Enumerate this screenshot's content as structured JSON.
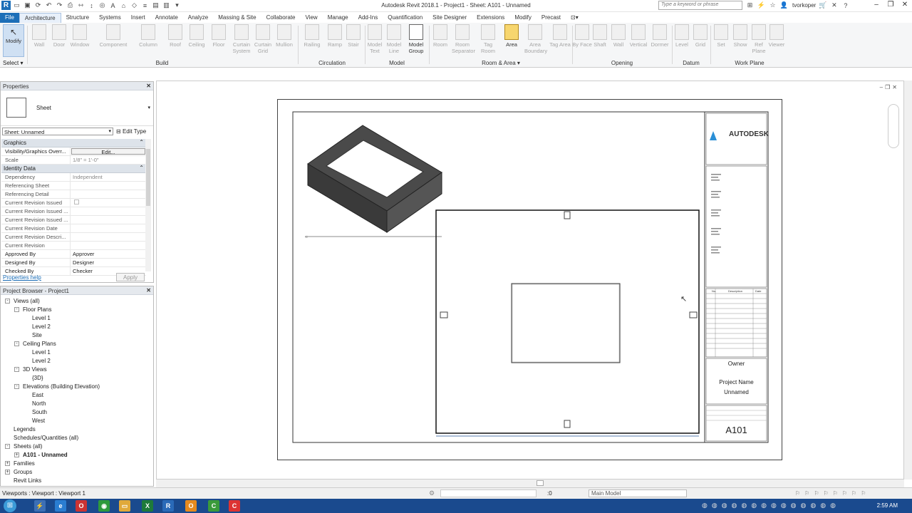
{
  "window": {
    "title": "Autodesk Revit 2018.1 -    Project1 - Sheet: A101 - Unnamed",
    "search_placeholder": "Type a keyword or phrase",
    "user": "tvorkoper"
  },
  "tabs": [
    "Architecture",
    "Structure",
    "Systems",
    "Insert",
    "Annotate",
    "Analyze",
    "Massing & Site",
    "Collaborate",
    "View",
    "Manage",
    "Add-Ins",
    "Quantification",
    "Site Designer",
    "Extensions",
    "Modify",
    "Precast"
  ],
  "file_tab": "File",
  "ribbon": {
    "modify": "Modify",
    "select": "Select",
    "buttons": [
      {
        "label": "Wall"
      },
      {
        "label": "Door"
      },
      {
        "label": "Window"
      },
      {
        "label": "Component"
      },
      {
        "label": "Column"
      },
      {
        "label": "Roof"
      },
      {
        "label": "Ceiling"
      },
      {
        "label": "Floor"
      },
      {
        "label": "Curtain System"
      },
      {
        "label": "Curtain Grid"
      },
      {
        "label": "Mullion"
      },
      {
        "label": "Railing"
      },
      {
        "label": "Ramp"
      },
      {
        "label": "Stair"
      },
      {
        "label": "Model Text"
      },
      {
        "label": "Model Line"
      },
      {
        "label": "Model Group"
      },
      {
        "label": "Room"
      },
      {
        "label": "Room Separator"
      },
      {
        "label": "Tag Room"
      },
      {
        "label": "Area"
      },
      {
        "label": "Area Boundary"
      },
      {
        "label": "Tag Area"
      },
      {
        "label": "By Face"
      },
      {
        "label": "Shaft"
      },
      {
        "label": "Wall"
      },
      {
        "label": "Vertical"
      },
      {
        "label": "Dormer"
      },
      {
        "label": "Level"
      },
      {
        "label": "Grid"
      },
      {
        "label": "Set"
      },
      {
        "label": "Show"
      },
      {
        "label": "Ref Plane"
      },
      {
        "label": "Viewer"
      }
    ],
    "panels": [
      "Build",
      "Circulation",
      "Model",
      "Room & Area",
      "Opening",
      "Datum",
      "Work Plane"
    ]
  },
  "properties": {
    "title": "Properties",
    "type": "Sheet",
    "instance": "Sheet: Unnamed",
    "edit_type": "Edit Type",
    "groups": [
      "Graphics",
      "Identity Data"
    ],
    "rows": [
      {
        "k": "Visibility/Graphics Overr...",
        "v": "Edit..."
      },
      {
        "k": "Scale",
        "v": "1/8\" = 1'-0\""
      },
      {
        "k": "Dependency",
        "v": "Independent"
      },
      {
        "k": "Referencing Sheet",
        "v": ""
      },
      {
        "k": "Referencing Detail",
        "v": ""
      },
      {
        "k": "Current Revision Issued",
        "v": ""
      },
      {
        "k": "Current Revision Issued ...",
        "v": ""
      },
      {
        "k": "Current Revision Issued ...",
        "v": ""
      },
      {
        "k": "Current Revision Date",
        "v": ""
      },
      {
        "k": "Current Revision Descri...",
        "v": ""
      },
      {
        "k": "Current Revision",
        "v": ""
      },
      {
        "k": "Approved By",
        "v": "Approver"
      },
      {
        "k": "Designed By",
        "v": "Designer"
      },
      {
        "k": "Checked By",
        "v": "Checker"
      }
    ],
    "help": "Properties help",
    "apply": "Apply"
  },
  "browser": {
    "title": "Project Browser - Project1",
    "items": [
      {
        "label": "Views (all)",
        "level": 0,
        "tog": "-"
      },
      {
        "label": "Floor Plans",
        "level": 1,
        "tog": "-"
      },
      {
        "label": "Level 1",
        "level": 2
      },
      {
        "label": "Level 2",
        "level": 2
      },
      {
        "label": "Site",
        "level": 2
      },
      {
        "label": "Ceiling Plans",
        "level": 1,
        "tog": "-"
      },
      {
        "label": "Level 1",
        "level": 2
      },
      {
        "label": "Level 2",
        "level": 2
      },
      {
        "label": "3D Views",
        "level": 1,
        "tog": "-"
      },
      {
        "label": "{3D}",
        "level": 2
      },
      {
        "label": "Elevations (Building Elevation)",
        "level": 1,
        "tog": "-"
      },
      {
        "label": "East",
        "level": 2
      },
      {
        "label": "North",
        "level": 2
      },
      {
        "label": "South",
        "level": 2
      },
      {
        "label": "West",
        "level": 2
      },
      {
        "label": "Legends",
        "level": 0
      },
      {
        "label": "Schedules/Quantities (all)",
        "level": 0
      },
      {
        "label": "Sheets (all)",
        "level": 0,
        "tog": "-"
      },
      {
        "label": "A101 - Unnamed",
        "level": 1,
        "tog": "+",
        "bold": true
      },
      {
        "label": "Families",
        "level": 0,
        "tog": "+"
      },
      {
        "label": "Groups",
        "level": 0,
        "tog": "+"
      },
      {
        "label": "Revit Links",
        "level": 0
      }
    ]
  },
  "titleblock": {
    "brand": "AUTODESK",
    "owner": "Owner",
    "project_name": "Project Name",
    "project_sub": "Unnamed",
    "sheet_number": "A101",
    "rev_headers": [
      "No.",
      "Description",
      "Date"
    ]
  },
  "status": {
    "text": "Viewports : Viewport : Viewport 1",
    "zero": ":0",
    "model": "Main Model"
  },
  "clock": "2:59 AM"
}
